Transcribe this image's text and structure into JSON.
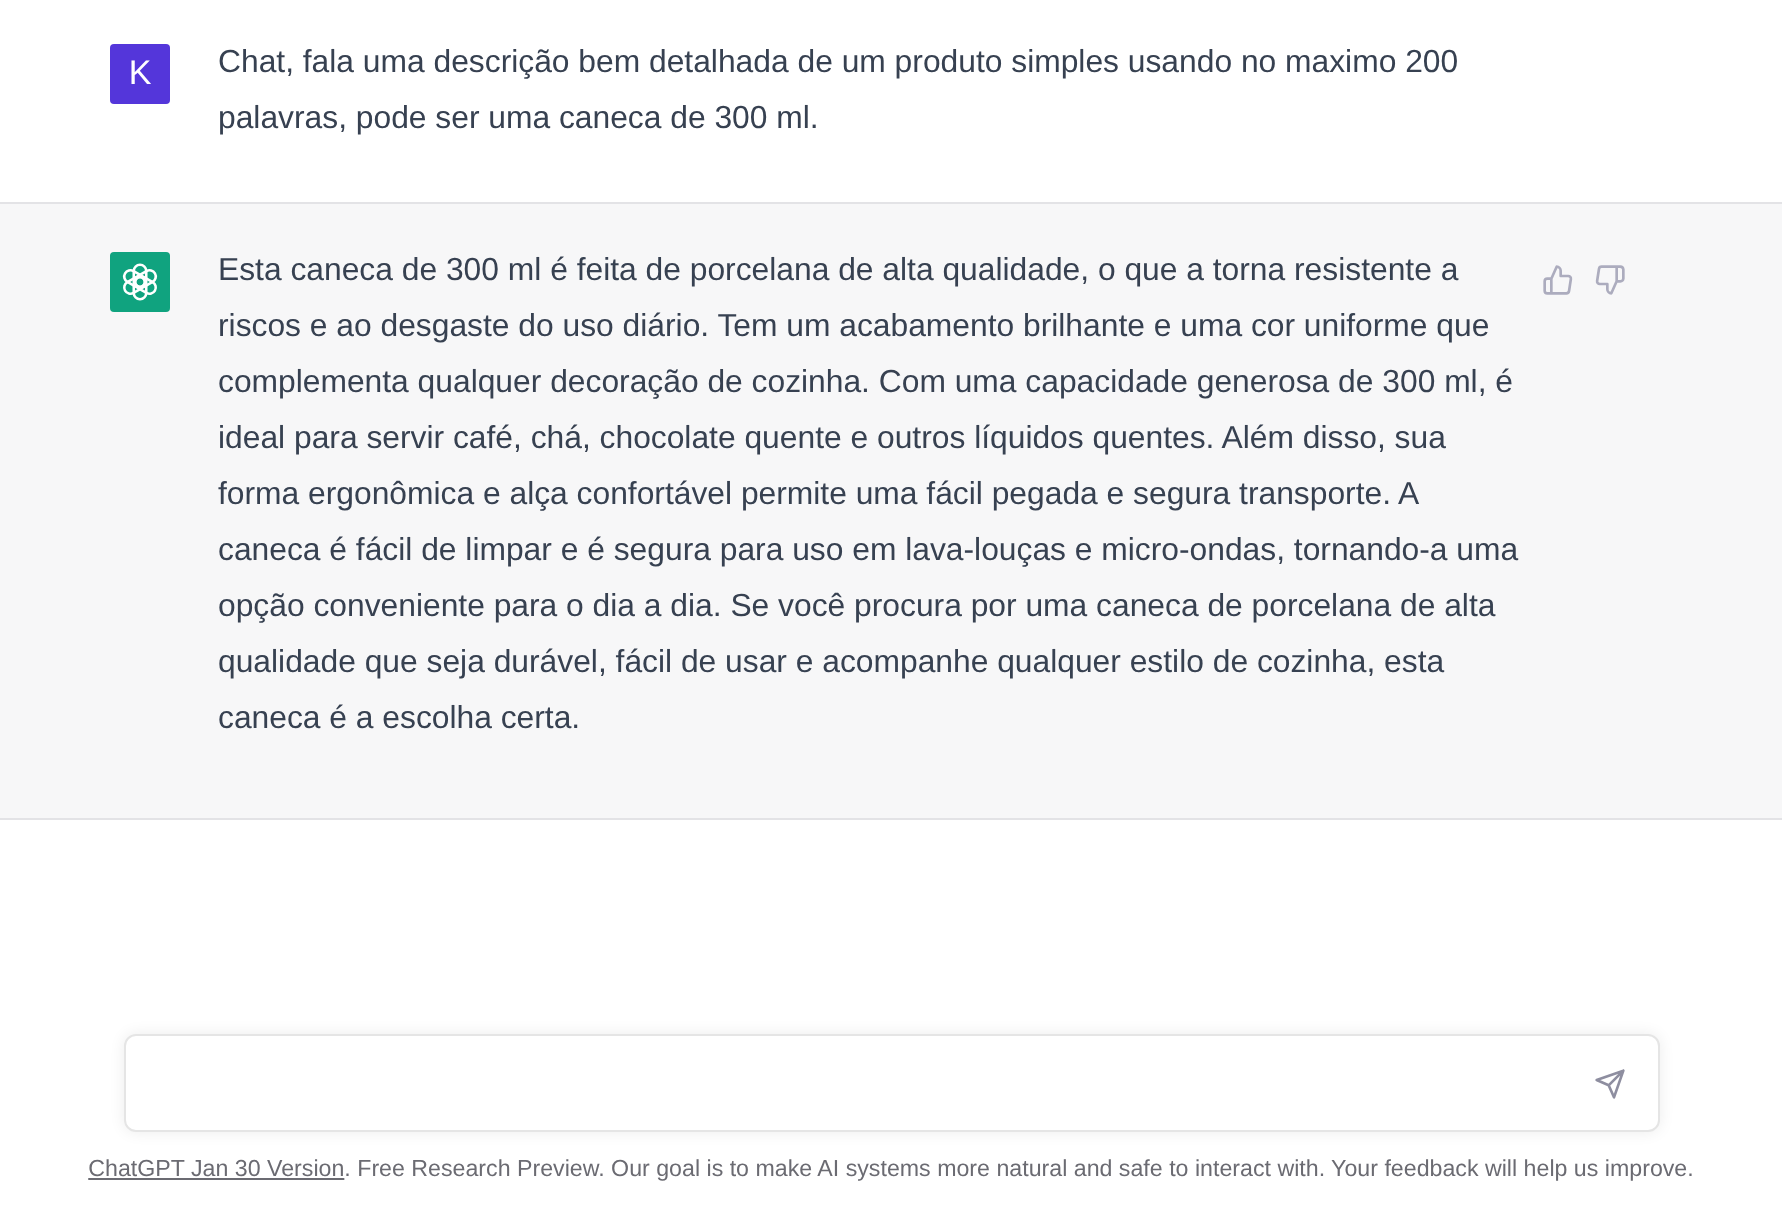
{
  "messages": [
    {
      "kind": "user",
      "avatar_letter": "K",
      "text": "Chat, fala uma descrição bem detalhada de um produto simples usando no maximo 200 palavras, pode ser uma caneca de 300 ml."
    },
    {
      "kind": "assistant",
      "text": "Esta caneca de 300 ml é feita de porcelana de alta qualidade, o que a torna resistente a riscos e ao desgaste do uso diário. Tem um acabamento brilhante e uma cor uniforme que complementa qualquer decoração de cozinha. Com uma capacidade generosa de 300 ml, é ideal para servir café, chá, chocolate quente e outros líquidos quentes. Além disso, sua forma ergonômica e alça confortável permite uma fácil pegada e segura transporte. A caneca é fácil de limpar e é segura para uso em lava-louças e micro-ondas, tornando-a uma opção conveniente para o dia a dia. Se você procura por uma caneca de porcelana de alta qualidade que seja durável, fácil de usar e acompanhe qualquer estilo de cozinha, esta caneca é a escolha certa."
    }
  ],
  "footer": {
    "link": "ChatGPT Jan 30 Version",
    "text": ". Free Research Preview. Our goal is to make AI systems more natural and safe to interact with. Your feedback will help us improve."
  }
}
